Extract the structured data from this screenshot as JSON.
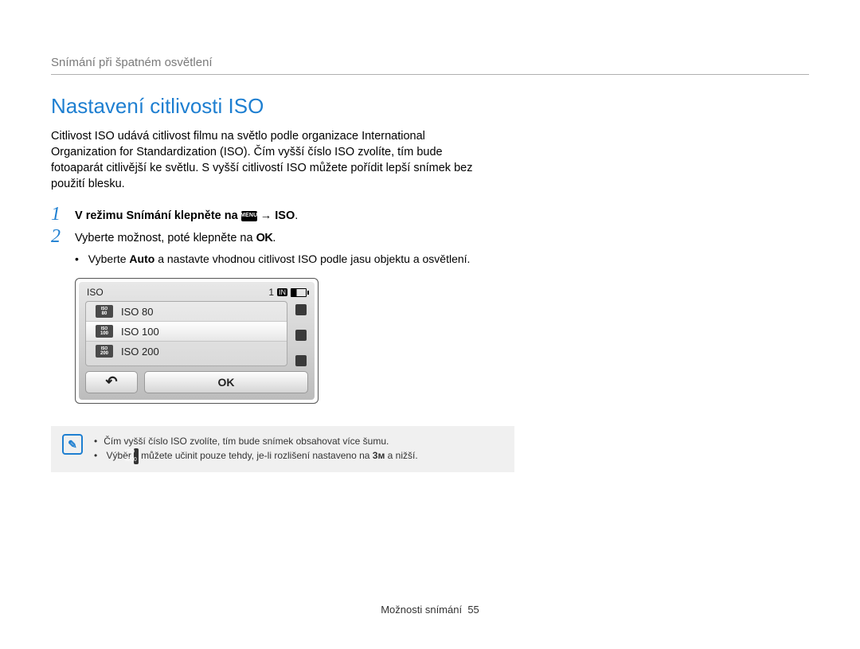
{
  "breadcrumb": "Snímání při špatném osvětlení",
  "title": "Nastavení citlivosti ISO",
  "intro": "Citlivost ISO udává citlivost filmu na světlo podle organizace International Organization for Standardization (ISO). Čím vyšší číslo ISO zvolíte, tím bude fotoaparát citlivější ke světlu. S vyšší citlivostí ISO můžete pořídit lepší snímek bez použití blesku.",
  "steps": [
    {
      "num": "1",
      "pre": "V režimu Snímání klepněte na ",
      "menu_label": "MENU",
      "arrow": " → ",
      "suffix": "ISO",
      "end": "."
    },
    {
      "num": "2",
      "pre": "Vyberte možnost, poté klepněte na ",
      "ok_label": "OK",
      "end": "."
    }
  ],
  "sub_bullet": {
    "pre": "Vyberte ",
    "bold": "Auto",
    "post": " a nastavte vhodnou citlivost ISO podle jasu objektu a osvětlení."
  },
  "camera": {
    "title": "ISO",
    "count": "1",
    "card": "IN",
    "rows": [
      {
        "value": "80",
        "label": "ISO 80",
        "selected": false
      },
      {
        "value": "100",
        "label": "ISO 100",
        "selected": true
      },
      {
        "value": "200",
        "label": "ISO 200",
        "selected": false
      }
    ],
    "back_symbol": "↶",
    "ok": "OK"
  },
  "note": {
    "icon": "✎",
    "items": [
      "Čím vyšší číslo ISO zvolíte, tím bude snímek obsahovat více šumu.",
      {
        "pre": "Výběr ",
        "iso_tag": "ISO 3200",
        "mid": " můžete učinit pouze tehdy, je-li rozlišení nastaveno na ",
        "size": "3ᴍ",
        "post": " a nižší."
      }
    ]
  },
  "footer": {
    "label": "Možnosti snímání",
    "page": "55"
  }
}
